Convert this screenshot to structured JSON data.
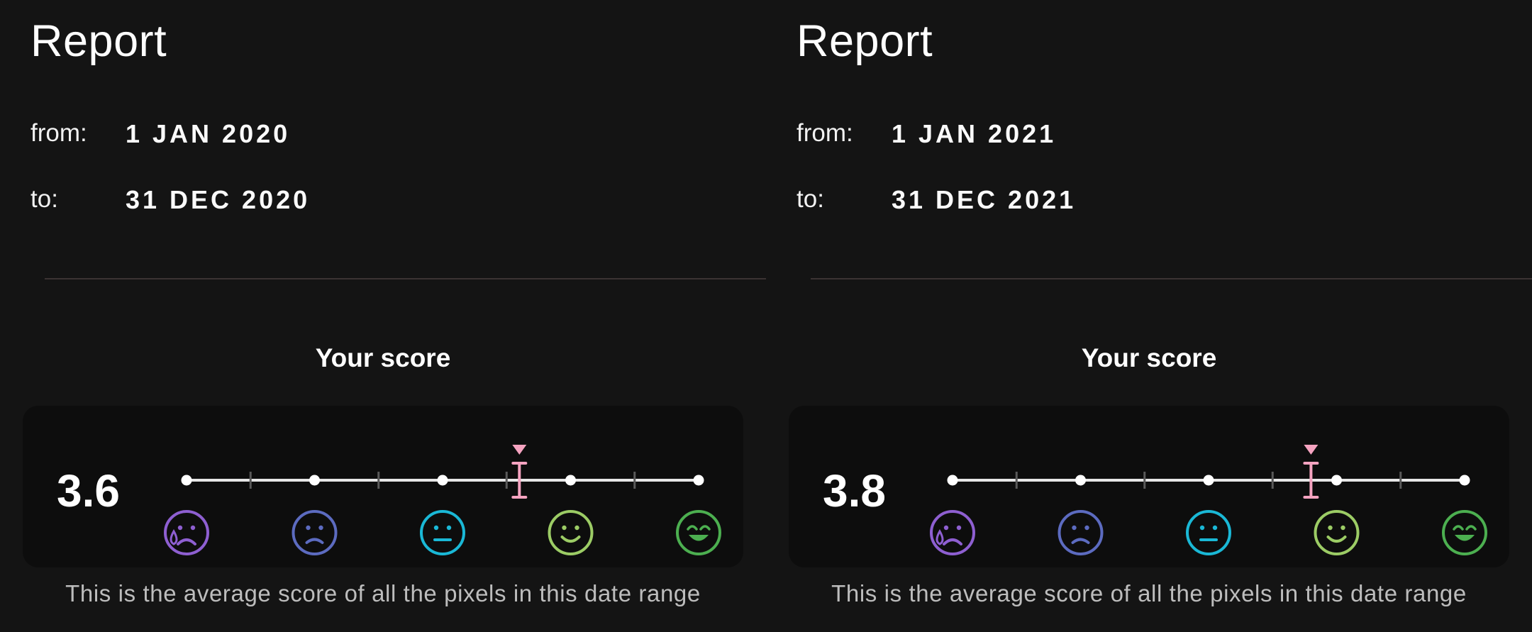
{
  "panels": [
    {
      "title": "Report",
      "from_label": "from:",
      "from_value": "1 JAN 2020",
      "to_label": "to:",
      "to_value": "31 DEC 2020",
      "score_heading": "Your score",
      "score_value": "3.6",
      "score": 3.6,
      "caption": "This is the average score of all the pixels in this date range"
    },
    {
      "title": "Report",
      "from_label": "from:",
      "from_value": "1 JAN 2021",
      "to_label": "to:",
      "to_value": "31 DEC 2021",
      "score_heading": "Your score",
      "score_value": "3.8",
      "score": 3.8,
      "caption": "This is the average score of all the pixels in this date range"
    }
  ],
  "scale": {
    "min": 1,
    "max": 5,
    "marker_color": "#f5a3c0",
    "line_color": "#e6e6e6",
    "tick_color": "#5a5a5a",
    "moods": [
      {
        "icon": "crying-face-icon",
        "color": "#8e5fd1"
      },
      {
        "icon": "sad-face-icon",
        "color": "#5c6bc0"
      },
      {
        "icon": "neutral-face-icon",
        "color": "#1ab8d6"
      },
      {
        "icon": "smiling-face-icon",
        "color": "#9ccc65"
      },
      {
        "icon": "grinning-face-icon",
        "color": "#4caf50"
      }
    ]
  }
}
